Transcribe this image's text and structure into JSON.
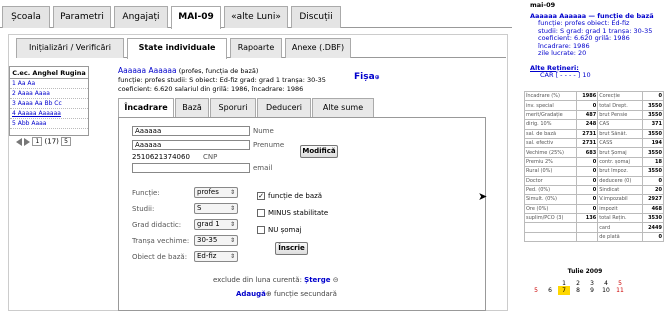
{
  "top_tabs": [
    "Școala",
    "Parametri",
    "Angajați",
    "MAI-09",
    "«alte Luni»",
    "Discuții"
  ],
  "sub_tabs": [
    "Inițializări / Verificări",
    "State individuale",
    "Rapoarte",
    "Anexe (.DBF)"
  ],
  "left_list": {
    "header": "C.ec. Anghel Rugina",
    "items": [
      "1 Aa Aa",
      "2 Aaaa Aaaa",
      "3 Aaaa Aa Bb Cc",
      "4 Aaaaa Aaaaaa",
      "5 Abb Aaaa"
    ]
  },
  "pager": {
    "page": "1",
    "total": "(17)",
    "size": "5"
  },
  "employee": {
    "name": "Aaaaaa Aaaaaa",
    "role_note": "(profes, funcția de bază)",
    "line2": "funcție: profes studii: S obiect: Ed-fiz grad: grad 1 tranșa: 30-35",
    "line3": "coeficient: 6.620 salariul din grilă: 1986, încadrare: 1986"
  },
  "fisa_link": "Fișa",
  "inner_tabs": [
    "Încadrare",
    "Bază",
    "Sporuri",
    "Deduceri",
    "Alte sume"
  ],
  "form": {
    "surname": "Aaaaaa",
    "surname_label": "Nume",
    "firstname": "Aaaaaa",
    "firstname_label": "Prenume",
    "cnp": "2510621374060",
    "cnp_label": "CNP",
    "email_label": "email",
    "modify_button": "Modifică",
    "fields": [
      {
        "label": "Funcție:",
        "value": "profes"
      },
      {
        "label": "Studii:",
        "value": "S"
      },
      {
        "label": "Grad didactic:",
        "value": "grad 1"
      },
      {
        "label": "Tranșa vechime:",
        "value": "30-35"
      },
      {
        "label": "Obiect de bază:",
        "value": "Ed-fiz"
      }
    ],
    "check_base": "funcție de bază",
    "check_minus": "MINUS stabilitate",
    "check_nu": "NU șomaj",
    "register_button": "Înscrie",
    "exclude_text": "exclude din luna curentă:",
    "exclude_link": "Șterge",
    "add_link": "Adaugă",
    "add_text": "funcție secundară"
  },
  "right_head": {
    "month": "mai-09",
    "title": "Aaaaaa Aaaaaa — funcție de bază",
    "lines": [
      "funcție: profes obiect: Ed-fiz",
      "studii: S grad: grad 1 tranșa: 30-35",
      "coeficient: 6.620 grilă: 1986",
      "încadrare: 1986",
      "zile lucrate: 20"
    ],
    "retineri_label": "Alte Rețineri:",
    "retineri_value": "CAR [ - - - - ] 10"
  },
  "right_table": [
    [
      "încadrare (%)",
      "1986",
      "Corecție",
      "0"
    ],
    [
      "inv. special",
      "0",
      "total Drept.",
      "3550"
    ],
    [
      "merit/Gradație",
      "487",
      "brut Pensie",
      "3550"
    ],
    [
      "dirig. 10%",
      "248",
      "CAS",
      "371"
    ],
    [
      "sal. de bază",
      "2731",
      "brut Sănăt.",
      "3550"
    ],
    [
      "sal. efectiv",
      "2731",
      "CASS",
      "194"
    ],
    [
      "Vechime (25%)",
      "683",
      "brut Șomaj",
      "3550"
    ],
    [
      "Premiu 2%",
      "0",
      "contr. șomaj",
      "18"
    ],
    [
      "Rural (0%)",
      "0",
      "brut Impoz.",
      "3550"
    ],
    [
      "Doctor",
      "0",
      "deducere (0)",
      "0"
    ],
    [
      "Ped. (0%)",
      "0",
      "Sindicat",
      "20"
    ],
    [
      "Simult. (0%)",
      "0",
      "V.impozabil",
      "2927"
    ],
    [
      "Ore (0%)",
      "0",
      "impozit",
      "468"
    ],
    [
      "suplim/PCO (3)",
      "136",
      "total Rețin.",
      "3530"
    ],
    [
      "",
      "",
      "card",
      "2449"
    ],
    [
      "",
      "",
      "de plată",
      "0"
    ]
  ],
  "calendar": {
    "caption": "Tulie 2009",
    "row1": [
      "",
      "",
      "1",
      "2",
      "3",
      "4",
      "5"
    ],
    "row2": [
      "5",
      "6",
      "7",
      "8",
      "9",
      "10",
      "11"
    ]
  }
}
